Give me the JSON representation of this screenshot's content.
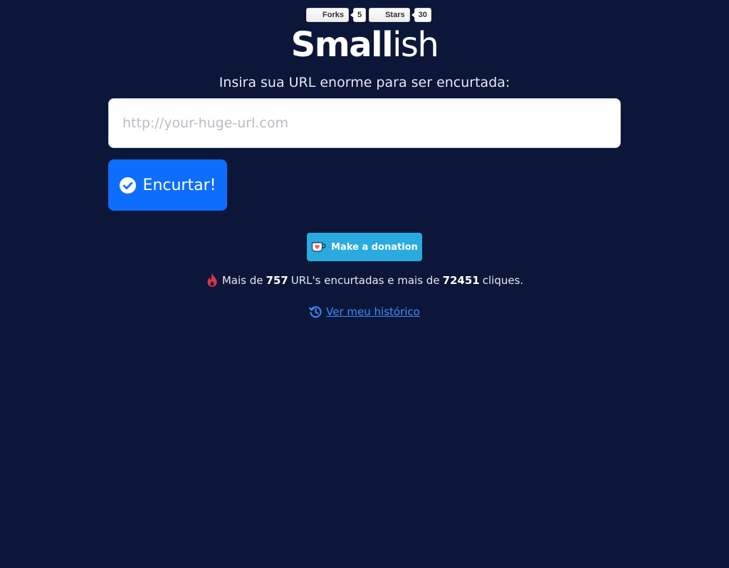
{
  "github": {
    "forks_label": "Forks",
    "forks_count": "5",
    "stars_label": "Stars",
    "stars_count": "30"
  },
  "logo": {
    "bold": "Small",
    "light": "ish"
  },
  "prompt": "Insira sua URL enorme para ser encurtada:",
  "url_input": {
    "value": "",
    "placeholder": "http://your-huge-url.com"
  },
  "shorten_button": {
    "label": "Encurtar!",
    "icon": "check-circle-icon"
  },
  "donation": {
    "label": "Make a donation",
    "icon": "kofi-cup-icon"
  },
  "stats": {
    "prefix": "Mais de",
    "urls_count": "757",
    "middle": "URL's encurtadas e mais de",
    "clicks_count": "72451",
    "suffix": "cliques.",
    "icon": "fire-icon"
  },
  "history": {
    "label": "Ver meu histórico",
    "icon": "history-icon"
  },
  "colors": {
    "background": "#0b1638",
    "primary": "#0d6efd",
    "donate": "#29abe0",
    "fire": "#dc3545",
    "link": "#3d8bfd"
  }
}
